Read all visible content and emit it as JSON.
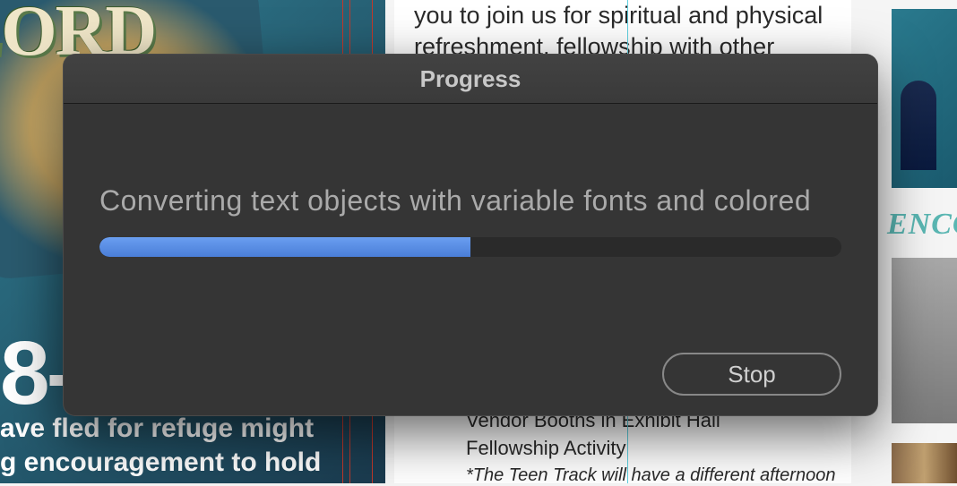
{
  "modal": {
    "title": "Progress",
    "status_text": "Converting text objects with variable fonts and colored",
    "progress_percent": 50,
    "stop_label": "Stop"
  },
  "background": {
    "left_banner_word": "LORD",
    "left_banner_num": "8-",
    "left_banner_para_line1": "ave fled for refuge might",
    "left_banner_para_line2": "g encouragement to hold",
    "center_top_text": "you to join us for spiritual and physical refreshment, fellowship with other believers,",
    "center_mid_line1": "Vendor Booths in Exhibit Hall",
    "center_mid_line2": "Fellowship Activity",
    "center_italic": "*The Teen Track will have a different afternoon",
    "right_title": "ENCO"
  }
}
